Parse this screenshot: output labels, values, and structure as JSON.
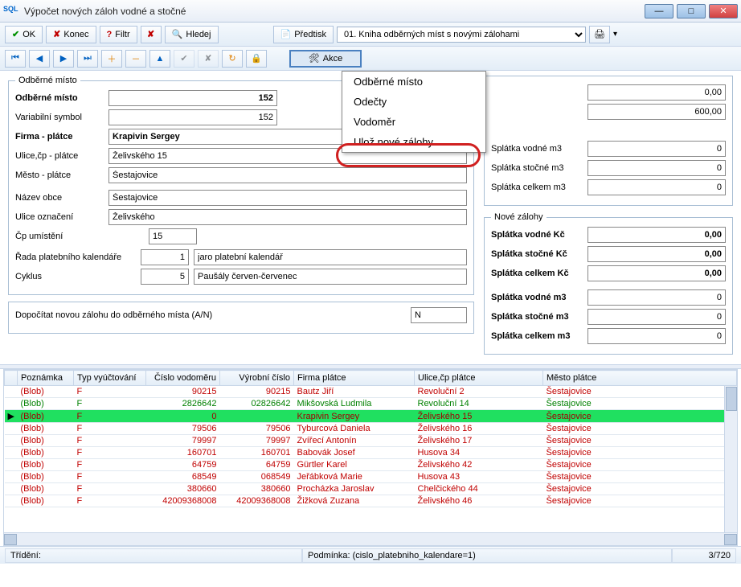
{
  "window": {
    "title": "Výpočet nových záloh vodné a stočné"
  },
  "toolbar1": {
    "ok": "OK",
    "konec": "Konec",
    "filtr": "Filtr",
    "hledej": "Hledej",
    "predtisk": "Předtisk",
    "report_select": "01. Kniha odběrných míst s novými zálohami"
  },
  "toolbar2": {
    "akce": "Akce"
  },
  "menu": {
    "item1": "Odběrné místo",
    "item2": "Odečty",
    "item3": "Vodoměr",
    "item4": "Ulož nové zálohy"
  },
  "left": {
    "legend": "Odběrné místo",
    "lbl_odberne": "Odběrné místo",
    "val_odberne": "152",
    "lbl_vars": "Variabilní symbol",
    "val_vars": "152",
    "lbl_firma": "Firma - plátce",
    "val_firma": "Krapivin Sergey",
    "lbl_ulice_cp": "Ulice,čp - plátce",
    "val_ulice_cp": "Želivského 15",
    "lbl_mesto": "Město - plátce",
    "val_mesto": "Šestajovice",
    "lbl_obec": "Název obce",
    "val_obec": "Šestajovice",
    "lbl_ulice_ozn": "Ulice označení",
    "val_ulice_ozn": "Želivského",
    "lbl_cp": "Čp umístění",
    "val_cp": "15",
    "lbl_rada": "Řada platebního kalendáře",
    "val_rada_num": "1",
    "val_rada_txt": "jaro platební kalendář",
    "lbl_cyklus": "Cyklus",
    "val_cyklus_num": "5",
    "val_cyklus_txt": "Paušály červen-červenec",
    "lbl_dopocitat": "Dopočítat novou zálohu do odběrného místa (A/N)",
    "val_dopocitat": "N"
  },
  "right": {
    "legend1_hidden": "",
    "r1_v1": "0,00",
    "r1_v2": "600,00",
    "lbl_sp_v_m3": "Splátka vodné m3",
    "val_sp_v_m3": "0",
    "lbl_sp_s_m3": "Splátka stočné m3",
    "val_sp_s_m3": "0",
    "lbl_sp_c_m3": "Splátka celkem m3",
    "val_sp_c_m3": "0",
    "legend2": "Nové zálohy",
    "lbl_n_v_kc": "Splátka vodné Kč",
    "val_n_v_kc": "0,00",
    "lbl_n_s_kc": "Splátka stočné Kč",
    "val_n_s_kc": "0,00",
    "lbl_n_c_kc": "Splátka celkem Kč",
    "val_n_c_kc": "0,00",
    "lbl_n_v_m3": "Splátka vodné m3",
    "val_n_v_m3": "0",
    "lbl_n_s_m3": "Splátka stočné m3",
    "val_n_s_m3": "0",
    "lbl_n_c_m3": "Splátka celkem m3",
    "val_n_c_m3": "0"
  },
  "grid": {
    "headers": [
      "",
      "Poznámka",
      "Typ vyúčtování",
      "Číslo vodoměru",
      "Výrobní číslo",
      "Firma plátce",
      "Ulice,čp plátce",
      "Město plátce"
    ],
    "rows": [
      {
        "m": "",
        "p": "(Blob)",
        "t": "F",
        "cv": "90215",
        "vc": "90215",
        "fp": "Bautz Jiří",
        "uc": "Revoluční 2",
        "mp": "Šestajovice",
        "cls": ""
      },
      {
        "m": "",
        "p": "(Blob)",
        "t": "F",
        "cv": "2826642",
        "vc": "02826642",
        "fp": "Mikšovská Ludmila",
        "uc": "Revoluční 14",
        "mp": "Šestajovice",
        "cls": "green-row"
      },
      {
        "m": "▶",
        "p": "(Blob)",
        "t": "F",
        "cv": "0",
        "vc": "",
        "fp": "Krapivin Sergey",
        "uc": "Želivského 15",
        "mp": "Šestajovice",
        "cls": "sel-row"
      },
      {
        "m": "",
        "p": "(Blob)",
        "t": "F",
        "cv": "79506",
        "vc": "79506",
        "fp": "Tyburcová Daniela",
        "uc": "Želivského 16",
        "mp": "Šestajovice",
        "cls": ""
      },
      {
        "m": "",
        "p": "(Blob)",
        "t": "F",
        "cv": "79997",
        "vc": "79997",
        "fp": "Zvířecí Antonín",
        "uc": "Želivského 17",
        "mp": "Šestajovice",
        "cls": ""
      },
      {
        "m": "",
        "p": "(Blob)",
        "t": "F",
        "cv": "160701",
        "vc": "160701",
        "fp": "Babovák Josef",
        "uc": "Husova 34",
        "mp": "Šestajovice",
        "cls": ""
      },
      {
        "m": "",
        "p": "(Blob)",
        "t": "F",
        "cv": "64759",
        "vc": "64759",
        "fp": "Gürtler Karel",
        "uc": "Želivského 42",
        "mp": "Šestajovice",
        "cls": ""
      },
      {
        "m": "",
        "p": "(Blob)",
        "t": "F",
        "cv": "68549",
        "vc": "068549",
        "fp": "Jeřábková Marie",
        "uc": "Husova 43",
        "mp": "Šestajovice",
        "cls": ""
      },
      {
        "m": "",
        "p": "(Blob)",
        "t": "F",
        "cv": "380660",
        "vc": "380660",
        "fp": "Procházka Jaroslav",
        "uc": "Chelčického 44",
        "mp": "Šestajovice",
        "cls": ""
      },
      {
        "m": "",
        "p": "(Blob)",
        "t": "F",
        "cv": "42009368008",
        "vc": "42009368008",
        "fp": "Žižková Zuzana",
        "uc": "Želivského 46",
        "mp": "Šestajovice",
        "cls": ""
      }
    ]
  },
  "status": {
    "sort": "Třídění:",
    "cond": "Podmínka: (cislo_platebniho_kalendare=1)",
    "count": "3/720"
  }
}
